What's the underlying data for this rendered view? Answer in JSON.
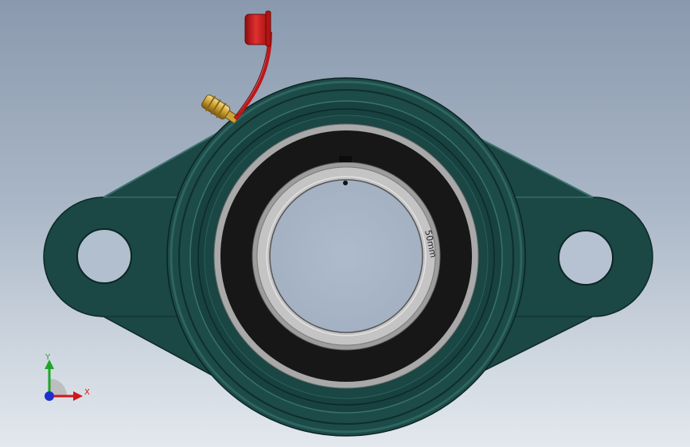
{
  "model": {
    "bore_label": "50mm"
  },
  "triad": {
    "x_label": "X",
    "y_label": "Y"
  },
  "colors": {
    "housing": "#1d4a47",
    "housing_dark": "#123532",
    "insert_dark": "#151515",
    "insert_gray": "#a8a8a8",
    "grease_cap": "#c51a1a",
    "grease_fitting": "#c9a33a",
    "axis_x": "#d01818",
    "axis_y": "#1fa52a",
    "axis_z": "#1e2fd0"
  }
}
